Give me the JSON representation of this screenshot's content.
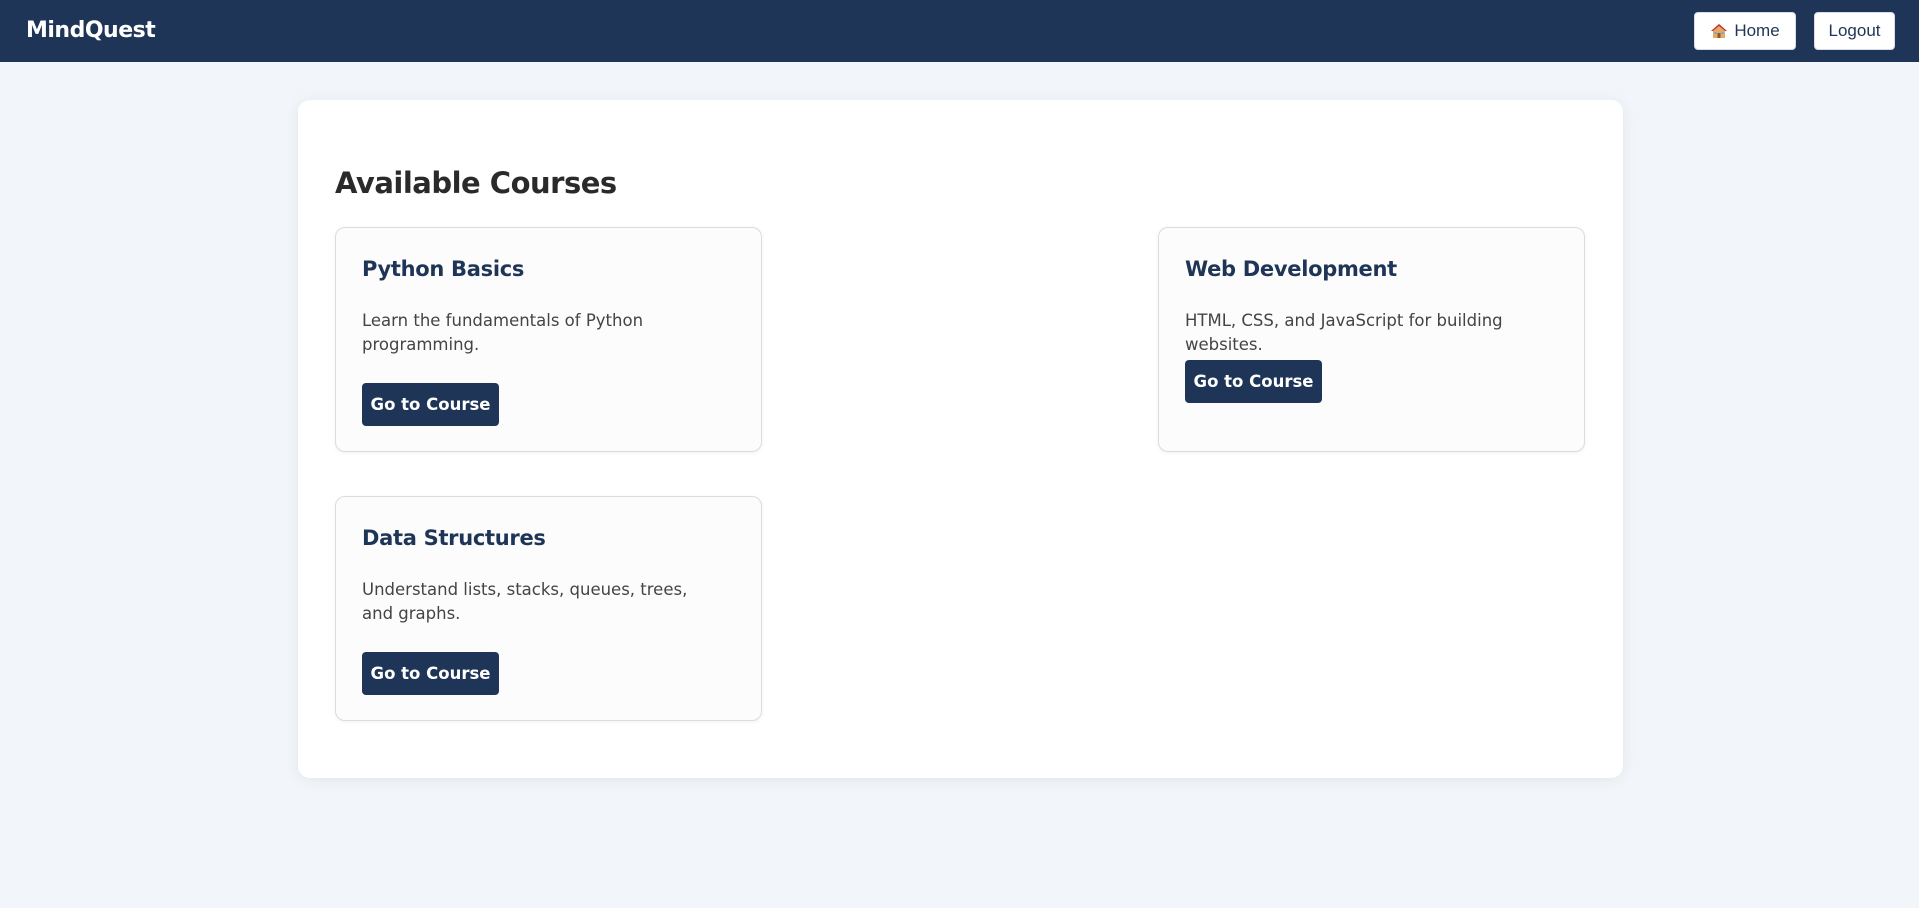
{
  "navbar": {
    "brand": "MindQuest",
    "home_icon": "house-icon",
    "home_label": "Home",
    "logout_label": "Logout"
  },
  "main": {
    "title": "Available Courses",
    "courses": [
      {
        "title": "Python Basics",
        "description": "Learn the fundamentals of Python programming.",
        "button_label": "Go to Course"
      },
      {
        "title": "Web Development",
        "description": "HTML, CSS, and JavaScript for building websites.",
        "button_label": "Go to Course"
      },
      {
        "title": "Data Structures",
        "description": "Understand lists, stacks, queues, trees, and graphs.",
        "button_label": "Go to Course"
      }
    ]
  },
  "colors": {
    "navbar_bg": "#1e3557",
    "page_bg": "#f2f6fa",
    "accent": "#1e3557"
  }
}
